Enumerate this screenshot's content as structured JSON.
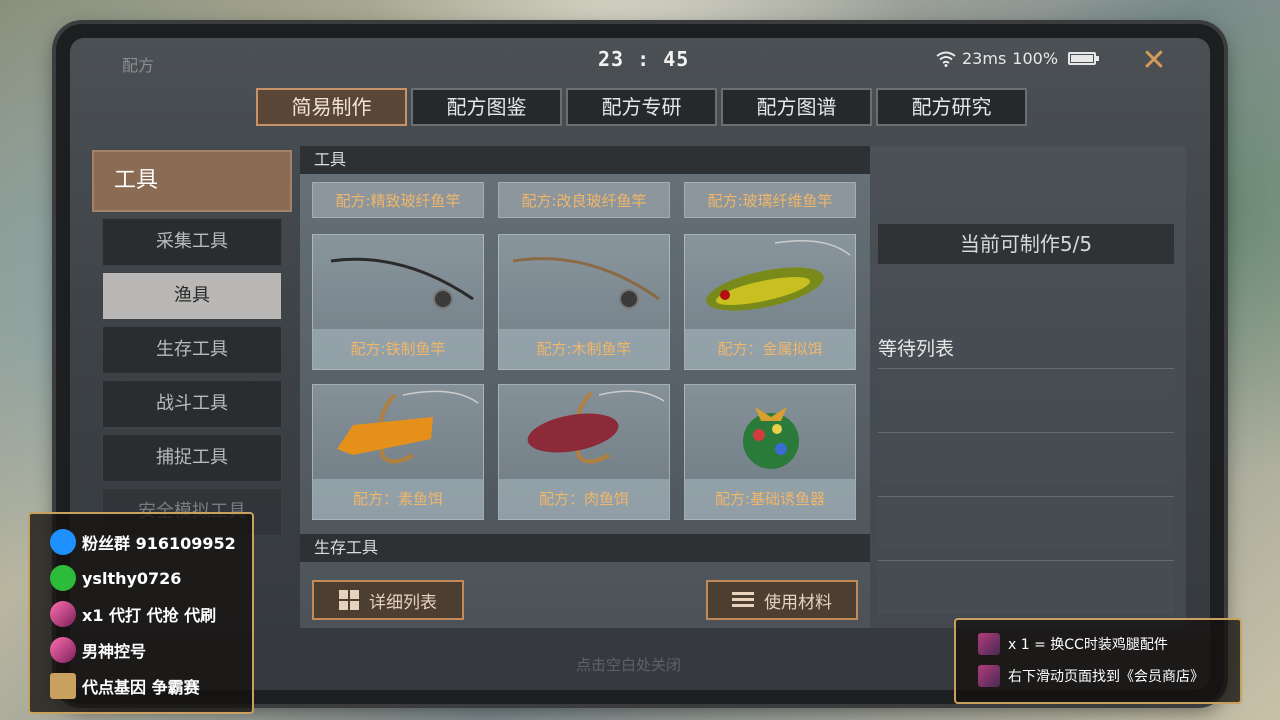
{
  "status": {
    "title": "配方",
    "time": "23 : 45",
    "ping": "23ms",
    "battery": "100%"
  },
  "close_label": "✕",
  "tabs": [
    {
      "label": "简易制作"
    },
    {
      "label": "配方图鉴"
    },
    {
      "label": "配方专研"
    },
    {
      "label": "配方图谱"
    },
    {
      "label": "配方研究"
    }
  ],
  "sidebar": {
    "header": "工具",
    "items": [
      {
        "label": "采集工具"
      },
      {
        "label": "渔具"
      },
      {
        "label": "生存工具"
      },
      {
        "label": "战斗工具"
      },
      {
        "label": "捕捉工具"
      },
      {
        "label": "安全模拟工具"
      }
    ]
  },
  "main": {
    "section1": "工具",
    "top_recipes": [
      "配方:精致玻纤鱼竿",
      "配方:改良玻纤鱼竿",
      "配方:玻璃纤维鱼竿"
    ],
    "cards": [
      {
        "label": "配方:铁制鱼竿",
        "icon": "fishing-rod-icon"
      },
      {
        "label": "配方:木制鱼竿",
        "icon": "fishing-rod-icon"
      },
      {
        "label": "配方：金属拟饵",
        "icon": "metal-lure-icon"
      },
      {
        "label": "配方：素鱼饵",
        "icon": "veggie-bait-icon"
      },
      {
        "label": "配方：肉鱼饵",
        "icon": "meat-bait-icon"
      },
      {
        "label": "配方:基础诱鱼器",
        "icon": "fish-attractor-icon"
      }
    ],
    "section2": "生存工具",
    "detail_list_btn": "详细列表",
    "use_materials_btn": "使用材料"
  },
  "right": {
    "can_make": "当前可制作5/5",
    "queue_title": "等待列表"
  },
  "tap_close": "点击空白处关闭",
  "overlay_left": {
    "rows": [
      {
        "text": "粉丝群 916109952",
        "icon": "qq-icon",
        "color": "#1e90ff"
      },
      {
        "text": "yslthy0726",
        "icon": "wechat-icon",
        "color": "#2dbb3a"
      },
      {
        "text": "x1 代打 代抢 代刷",
        "icon": "rocket-icon",
        "color": "#d03a86"
      },
      {
        "text": "男神控号",
        "icon": "rocket-icon",
        "color": "#d03a86"
      },
      {
        "text": "代点基因 争霸赛",
        "icon": "avatar-icon",
        "color": "#c9a05d"
      }
    ]
  },
  "overlay_right": {
    "rows": [
      {
        "text": "x 1 = 换CC时装鸡腿配件"
      },
      {
        "text": "右下滑动页面找到《会员商店》"
      }
    ]
  }
}
